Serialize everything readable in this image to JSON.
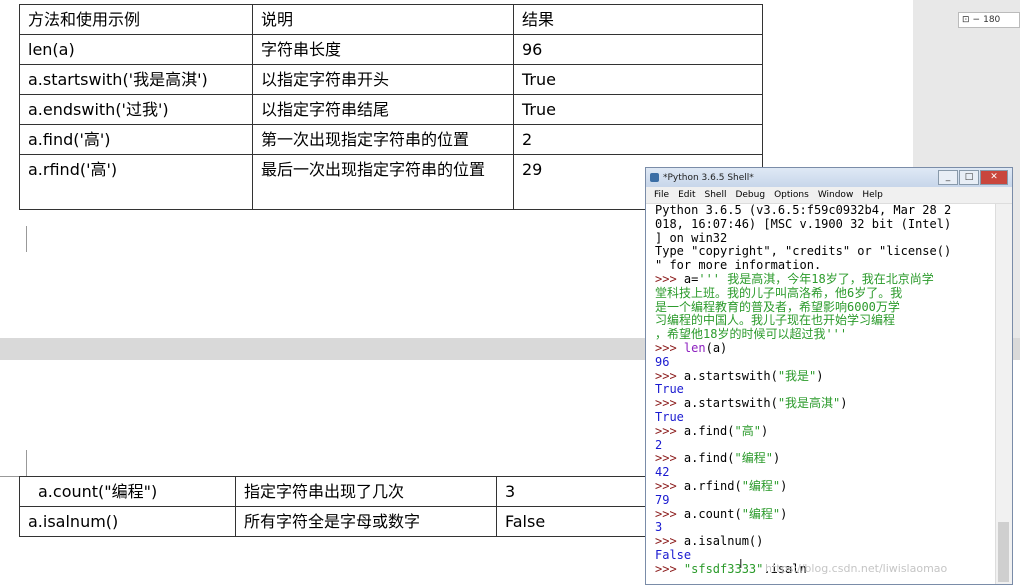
{
  "doc": {
    "table1": {
      "headers": [
        "方法和使用示例",
        "说明",
        "结果"
      ],
      "rows": [
        [
          "len(a)",
          "字符串长度",
          "96"
        ],
        [
          "a.startswith('我是高淇')",
          "以指定字符串开头",
          "True"
        ],
        [
          "a.endswith('过我')",
          "以指定字符串结尾",
          "True"
        ],
        [
          "a.find('高')",
          "第一次出现指定字符串的位置",
          "2"
        ],
        [
          "a.rfind('高')",
          "最后一次出现指定字符串的位置",
          "29"
        ]
      ]
    },
    "table2": {
      "rows": [
        [
          "a.count(\"编程\")",
          "指定字符串出现了几次",
          "3"
        ],
        [
          "a.isalnum()",
          "所有字符全是字母或数字",
          "False"
        ]
      ]
    },
    "zoom": "180"
  },
  "shell": {
    "title": "*Python 3.6.5 Shell*",
    "menu": [
      "File",
      "Edit",
      "Shell",
      "Debug",
      "Options",
      "Window",
      "Help"
    ],
    "lines": [
      {
        "parts": [
          {
            "c": "out",
            "t": "Python 3.6.5 (v3.6.5:f59c0932b4, Mar 28 2"
          }
        ]
      },
      {
        "parts": [
          {
            "c": "out",
            "t": "018, 16:07:46) [MSC v.1900 32 bit (Intel)"
          }
        ]
      },
      {
        "parts": [
          {
            "c": "out",
            "t": "] on win32"
          }
        ]
      },
      {
        "parts": [
          {
            "c": "out",
            "t": "Type \"copyright\", \"credits\" or \"license()"
          }
        ]
      },
      {
        "parts": [
          {
            "c": "out",
            "t": "\" for more information."
          }
        ]
      },
      {
        "parts": [
          {
            "c": "prm",
            "t": ">>> "
          },
          {
            "c": "inp",
            "t": "a="
          },
          {
            "c": "str",
            "t": "''' 我是高淇，今年18岁了，我在北京尚学"
          }
        ]
      },
      {
        "parts": [
          {
            "c": "str",
            "t": "堂科技上班。我的儿子叫高洛希，他6岁了。我"
          }
        ]
      },
      {
        "parts": [
          {
            "c": "str",
            "t": "是一个编程教育的普及者，希望影响6000万学"
          }
        ]
      },
      {
        "parts": [
          {
            "c": "str",
            "t": "习编程的中国人。我儿子现在也开始学习编程"
          }
        ]
      },
      {
        "parts": [
          {
            "c": "str",
            "t": "，希望他18岁的时候可以超过我'''"
          }
        ]
      },
      {
        "parts": [
          {
            "c": "prm",
            "t": ">>> "
          },
          {
            "c": "bi",
            "t": "len"
          },
          {
            "c": "inp",
            "t": "(a)"
          }
        ]
      },
      {
        "parts": [
          {
            "c": "res",
            "t": "96"
          }
        ]
      },
      {
        "parts": [
          {
            "c": "prm",
            "t": ">>> "
          },
          {
            "c": "inp",
            "t": "a.startswith("
          },
          {
            "c": "str",
            "t": "\"我是\""
          },
          {
            "c": "inp",
            "t": ")"
          }
        ]
      },
      {
        "parts": [
          {
            "c": "res",
            "t": "True"
          }
        ]
      },
      {
        "parts": [
          {
            "c": "prm",
            "t": ">>> "
          },
          {
            "c": "inp",
            "t": "a.startswith("
          },
          {
            "c": "str",
            "t": "\"我是高淇\""
          },
          {
            "c": "inp",
            "t": ")"
          }
        ]
      },
      {
        "parts": [
          {
            "c": "res",
            "t": "True"
          }
        ]
      },
      {
        "parts": [
          {
            "c": "prm",
            "t": ">>> "
          },
          {
            "c": "inp",
            "t": "a.find("
          },
          {
            "c": "str",
            "t": "\"高\""
          },
          {
            "c": "inp",
            "t": ")"
          }
        ]
      },
      {
        "parts": [
          {
            "c": "res",
            "t": "2"
          }
        ]
      },
      {
        "parts": [
          {
            "c": "prm",
            "t": ">>> "
          },
          {
            "c": "inp",
            "t": "a.find("
          },
          {
            "c": "str",
            "t": "\"编程\""
          },
          {
            "c": "inp",
            "t": ")"
          }
        ]
      },
      {
        "parts": [
          {
            "c": "res",
            "t": "42"
          }
        ]
      },
      {
        "parts": [
          {
            "c": "prm",
            "t": ">>> "
          },
          {
            "c": "inp",
            "t": "a.rfind("
          },
          {
            "c": "str",
            "t": "\"编程\""
          },
          {
            "c": "inp",
            "t": ")"
          }
        ]
      },
      {
        "parts": [
          {
            "c": "res",
            "t": "79"
          }
        ]
      },
      {
        "parts": [
          {
            "c": "prm",
            "t": ">>> "
          },
          {
            "c": "inp",
            "t": "a.count("
          },
          {
            "c": "str",
            "t": "\"编程\""
          },
          {
            "c": "inp",
            "t": ")"
          }
        ]
      },
      {
        "parts": [
          {
            "c": "res",
            "t": "3"
          }
        ]
      },
      {
        "parts": [
          {
            "c": "prm",
            "t": ">>> "
          },
          {
            "c": "inp",
            "t": "a.isalnum()"
          }
        ]
      },
      {
        "parts": [
          {
            "c": "res",
            "t": "False"
          }
        ]
      },
      {
        "parts": [
          {
            "c": "prm",
            "t": ">>> "
          },
          {
            "c": "str",
            "t": "\"sfsdf3333\""
          },
          {
            "c": "inp",
            "t": ".isaln"
          }
        ]
      }
    ]
  },
  "watermark": "https://blog.csdn.net/liwislaomao"
}
